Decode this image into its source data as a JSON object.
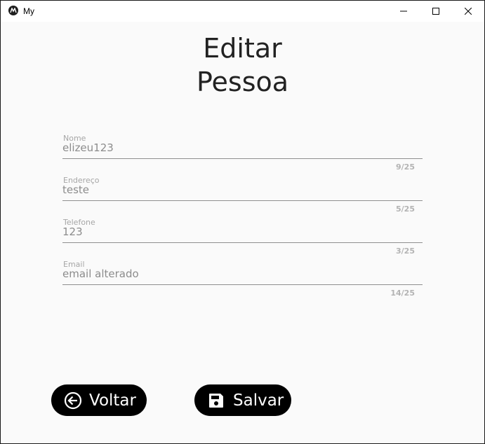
{
  "window": {
    "title": "My"
  },
  "page": {
    "title_line1": "Editar",
    "title_line2": "Pessoa"
  },
  "form": {
    "fields": [
      {
        "label": "Nome",
        "value": "elizeu123",
        "counter": "9/25"
      },
      {
        "label": "Endereço",
        "value": "teste",
        "counter": "5/25"
      },
      {
        "label": "Telefone",
        "value": "123",
        "counter": "3/25"
      },
      {
        "label": "Email",
        "value": "email alterado",
        "counter": "14/25"
      }
    ]
  },
  "actions": {
    "back_label": "Voltar",
    "back_icon": "arrow-left-circle-icon",
    "save_label": "Salvar",
    "save_icon": "floppy-disk-icon"
  },
  "colors": {
    "background": "#fafafa",
    "button": "#000000",
    "button_text": "#ffffff",
    "field_text": "#8c8c8c"
  }
}
